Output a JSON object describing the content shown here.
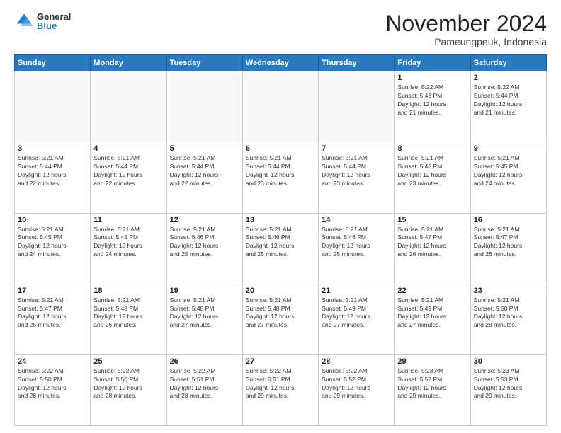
{
  "logo": {
    "general": "General",
    "blue": "Blue"
  },
  "header": {
    "month_year": "November 2024",
    "location": "Pameungpeuk, Indonesia"
  },
  "weekdays": [
    "Sunday",
    "Monday",
    "Tuesday",
    "Wednesday",
    "Thursday",
    "Friday",
    "Saturday"
  ],
  "weeks": [
    [
      {
        "day": "",
        "info": ""
      },
      {
        "day": "",
        "info": ""
      },
      {
        "day": "",
        "info": ""
      },
      {
        "day": "",
        "info": ""
      },
      {
        "day": "",
        "info": ""
      },
      {
        "day": "1",
        "info": "Sunrise: 5:22 AM\nSunset: 5:43 PM\nDaylight: 12 hours\nand 21 minutes."
      },
      {
        "day": "2",
        "info": "Sunrise: 5:22 AM\nSunset: 5:44 PM\nDaylight: 12 hours\nand 21 minutes."
      }
    ],
    [
      {
        "day": "3",
        "info": "Sunrise: 5:21 AM\nSunset: 5:44 PM\nDaylight: 12 hours\nand 22 minutes."
      },
      {
        "day": "4",
        "info": "Sunrise: 5:21 AM\nSunset: 5:44 PM\nDaylight: 12 hours\nand 22 minutes."
      },
      {
        "day": "5",
        "info": "Sunrise: 5:21 AM\nSunset: 5:44 PM\nDaylight: 12 hours\nand 22 minutes."
      },
      {
        "day": "6",
        "info": "Sunrise: 5:21 AM\nSunset: 5:44 PM\nDaylight: 12 hours\nand 23 minutes."
      },
      {
        "day": "7",
        "info": "Sunrise: 5:21 AM\nSunset: 5:44 PM\nDaylight: 12 hours\nand 23 minutes."
      },
      {
        "day": "8",
        "info": "Sunrise: 5:21 AM\nSunset: 5:45 PM\nDaylight: 12 hours\nand 23 minutes."
      },
      {
        "day": "9",
        "info": "Sunrise: 5:21 AM\nSunset: 5:45 PM\nDaylight: 12 hours\nand 24 minutes."
      }
    ],
    [
      {
        "day": "10",
        "info": "Sunrise: 5:21 AM\nSunset: 5:45 PM\nDaylight: 12 hours\nand 24 minutes."
      },
      {
        "day": "11",
        "info": "Sunrise: 5:21 AM\nSunset: 5:45 PM\nDaylight: 12 hours\nand 24 minutes."
      },
      {
        "day": "12",
        "info": "Sunrise: 5:21 AM\nSunset: 5:46 PM\nDaylight: 12 hours\nand 25 minutes."
      },
      {
        "day": "13",
        "info": "Sunrise: 5:21 AM\nSunset: 5:46 PM\nDaylight: 12 hours\nand 25 minutes."
      },
      {
        "day": "14",
        "info": "Sunrise: 5:21 AM\nSunset: 5:46 PM\nDaylight: 12 hours\nand 25 minutes."
      },
      {
        "day": "15",
        "info": "Sunrise: 5:21 AM\nSunset: 5:47 PM\nDaylight: 12 hours\nand 26 minutes."
      },
      {
        "day": "16",
        "info": "Sunrise: 5:21 AM\nSunset: 5:47 PM\nDaylight: 12 hours\nand 26 minutes."
      }
    ],
    [
      {
        "day": "17",
        "info": "Sunrise: 5:21 AM\nSunset: 5:47 PM\nDaylight: 12 hours\nand 26 minutes."
      },
      {
        "day": "18",
        "info": "Sunrise: 5:21 AM\nSunset: 5:48 PM\nDaylight: 12 hours\nand 26 minutes."
      },
      {
        "day": "19",
        "info": "Sunrise: 5:21 AM\nSunset: 5:48 PM\nDaylight: 12 hours\nand 27 minutes."
      },
      {
        "day": "20",
        "info": "Sunrise: 5:21 AM\nSunset: 5:48 PM\nDaylight: 12 hours\nand 27 minutes."
      },
      {
        "day": "21",
        "info": "Sunrise: 5:21 AM\nSunset: 5:49 PM\nDaylight: 12 hours\nand 27 minutes."
      },
      {
        "day": "22",
        "info": "Sunrise: 5:21 AM\nSunset: 5:49 PM\nDaylight: 12 hours\nand 27 minutes."
      },
      {
        "day": "23",
        "info": "Sunrise: 5:21 AM\nSunset: 5:50 PM\nDaylight: 12 hours\nand 28 minutes."
      }
    ],
    [
      {
        "day": "24",
        "info": "Sunrise: 5:22 AM\nSunset: 5:50 PM\nDaylight: 12 hours\nand 28 minutes."
      },
      {
        "day": "25",
        "info": "Sunrise: 5:22 AM\nSunset: 5:50 PM\nDaylight: 12 hours\nand 28 minutes."
      },
      {
        "day": "26",
        "info": "Sunrise: 5:22 AM\nSunset: 5:51 PM\nDaylight: 12 hours\nand 28 minutes."
      },
      {
        "day": "27",
        "info": "Sunrise: 5:22 AM\nSunset: 5:51 PM\nDaylight: 12 hours\nand 29 minutes."
      },
      {
        "day": "28",
        "info": "Sunrise: 5:22 AM\nSunset: 5:52 PM\nDaylight: 12 hours\nand 29 minutes."
      },
      {
        "day": "29",
        "info": "Sunrise: 5:23 AM\nSunset: 5:52 PM\nDaylight: 12 hours\nand 29 minutes."
      },
      {
        "day": "30",
        "info": "Sunrise: 5:23 AM\nSunset: 5:53 PM\nDaylight: 12 hours\nand 29 minutes."
      }
    ]
  ]
}
